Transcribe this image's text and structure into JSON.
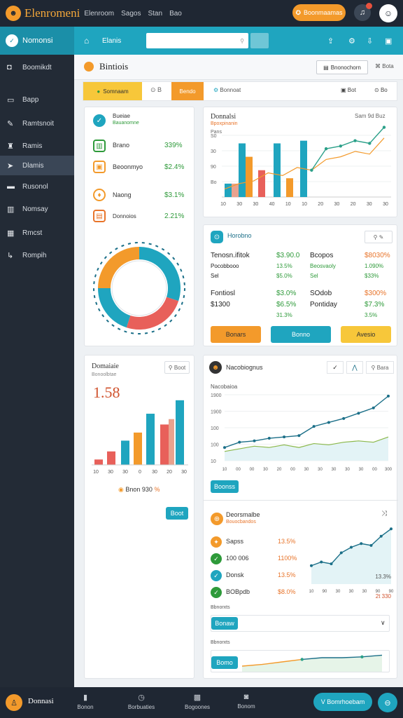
{
  "app": {
    "title": "Elenromeni",
    "nav": [
      "Elenroom",
      "Sagos",
      "Stan",
      "Bao"
    ],
    "top_button": "Boonmaamas"
  },
  "sidebar": {
    "header": "Nomonsi",
    "items": [
      {
        "label": "Boomikdt",
        "icon": "camera-icon"
      },
      {
        "label": "Bapp",
        "icon": "briefcase-icon"
      },
      {
        "label": "Ramtsnoit",
        "icon": "edit-icon"
      },
      {
        "label": "Ramis",
        "icon": "bag-icon"
      },
      {
        "label": "Dlamis",
        "icon": "send-icon",
        "active": true
      },
      {
        "label": "Rusonol",
        "icon": "inbox-icon"
      },
      {
        "label": "Nomsay",
        "icon": "building-icon"
      },
      {
        "label": "Rmcst",
        "icon": "grid-icon"
      },
      {
        "label": "Rompih",
        "icon": "export-icon"
      }
    ]
  },
  "main": {
    "tab_label": "Elanis",
    "page_title": "Bintiois",
    "header_button": "Bnonochorn",
    "header_link": "Bota"
  },
  "tabs": {
    "items": [
      "Somnaam",
      "Bendo",
      "Bonnoat"
    ],
    "gb": "B",
    "r1": "Bot",
    "r2": "Bo"
  },
  "summary": {
    "items": [
      {
        "label": "Bueiae",
        "sub": "Bauanomne"
      },
      {
        "label": "Brano",
        "value": "339%"
      },
      {
        "label": "Beoonmyo",
        "value": "$2.4%"
      },
      {
        "label": "Naong",
        "value": "$3.1%"
      },
      {
        "label": "Donnoios",
        "value": "2.21%"
      }
    ],
    "donut": {
      "segments": [
        {
          "value": 30,
          "color": "#1fa5bf"
        },
        {
          "value": 25,
          "color": "#e8605a"
        },
        {
          "value": 20,
          "color": "#1fa5bf"
        },
        {
          "value": 25,
          "color": "#f39a2b"
        }
      ]
    }
  },
  "bars1": {
    "title": "Donnalsi",
    "subtitle": "Bpoxpinanin",
    "legend": "Pans",
    "right_label": "Sam 9d Buz",
    "y_ticks": [
      "Bo",
      "90",
      "30",
      "S0"
    ],
    "x_ticks": [
      "10",
      "30",
      "30",
      "40",
      "10",
      "10",
      "20",
      "30",
      "20",
      "30",
      "30"
    ],
    "bars": [
      {
        "value": 10,
        "color": "#1fa5bf"
      },
      {
        "value": 10,
        "color": "#e8a28e"
      },
      {
        "value": 40,
        "color": "#1fa5bf"
      },
      {
        "value": 30,
        "color": "#f39a2b"
      },
      {
        "value": 20,
        "color": "#e8605a"
      },
      {
        "value": 40,
        "color": "#1fa5bf"
      },
      {
        "value": 14,
        "color": "#f39a2b"
      },
      {
        "value": 42,
        "color": "#1fa5bf"
      }
    ],
    "line": [
      6,
      10,
      12,
      18,
      16,
      22,
      20,
      28,
      30,
      34,
      32,
      44
    ]
  },
  "finance": {
    "title": "Horobno",
    "rows": [
      {
        "a": "Tenosn.ifitok",
        "b": "$3.90.0",
        "c": "Bcopos",
        "d": "$8030%"
      },
      {
        "a": "Pocobbooo",
        "b": "13.5%",
        "c": "Beosvaoly",
        "d": "1.090%"
      },
      {
        "a": "Sel",
        "b": "$5.0%",
        "c": "Sel",
        "d": "$33%"
      },
      {
        "a": "Fontiosl",
        "b": "$3.0%",
        "c": "SOdob",
        "d": "$300%"
      },
      {
        "a": "$1300",
        "b": "$6.5%",
        "c": "Pontiday",
        "d": "$7.3%"
      },
      {
        "a": "",
        "b": "31.3%",
        "c": "",
        "d": "3.5%"
      }
    ],
    "buttons": [
      "Bonars",
      "Bonno",
      "Avesio"
    ]
  },
  "kpi": {
    "title": "Domaiaie",
    "subtitle": "Bonoolbtae",
    "big_value": "1.58",
    "filter": "Boot",
    "legend": "Bnon 930",
    "legend_value": "%",
    "button": "Boot",
    "x_ticks": [
      "10",
      "30",
      "30",
      "0",
      "30",
      "20",
      "30"
    ],
    "bars": [
      {
        "value": 2,
        "color": "#e8605a"
      },
      {
        "value": 5,
        "color": "#e8605a"
      },
      {
        "value": 9,
        "color": "#1fa5bf"
      },
      {
        "value": 12,
        "color": "#f39a2b"
      },
      {
        "value": 19,
        "color": "#1fa5bf"
      },
      {
        "value": 15,
        "color": "#e8605a"
      },
      {
        "value": 17,
        "color": "#e8a28e"
      },
      {
        "value": 24,
        "color": "#1fa5bf"
      }
    ]
  },
  "trends": {
    "title": "Nacobiognus",
    "filter": "Bara",
    "subtitle": "Nacobaioa",
    "y_ticks": [
      "1900",
      "1900",
      "100",
      "100",
      "10"
    ],
    "x_ticks": [
      "10",
      "00",
      "00",
      "30",
      "20",
      "00",
      "30",
      "30",
      "30",
      "30",
      "30",
      "00",
      "300"
    ],
    "line_a": [
      20,
      28,
      30,
      34,
      36,
      38,
      52,
      58,
      64,
      72,
      80,
      98
    ],
    "line_b": [
      14,
      18,
      22,
      20,
      24,
      20,
      26,
      24,
      28,
      30,
      28,
      36
    ],
    "button": "Boonss"
  },
  "breakdown": {
    "title": "Deorsmalbe",
    "subtitle": "Bouocbandos",
    "items": [
      {
        "label": "Sapss",
        "value": "13.5%"
      },
      {
        "label": "100 006",
        "value": "1100%"
      },
      {
        "label": "Donsk",
        "value": "13.5%"
      },
      {
        "label": "BOBpdb",
        "value": "$8.0%"
      }
    ],
    "mini_line": [
      20,
      24,
      22,
      34,
      40,
      44,
      42,
      52,
      60
    ],
    "mini_x": [
      "10",
      "90",
      "30",
      "30",
      "30",
      "90",
      "90"
    ],
    "mini_right": "13.3%",
    "mini_bottom": "2t 330",
    "foot_label": "Bbnorxts",
    "select_a": "Bonaw",
    "select_b": "Bomo",
    "foot_line": [
      10,
      14,
      20,
      26,
      30,
      30,
      32,
      36
    ]
  },
  "bottom": {
    "user": "Donnasi",
    "items": [
      "Bonon",
      "Borbuaties",
      "Bogoones",
      "Bonom"
    ],
    "button": "V Bomrhoebam"
  }
}
